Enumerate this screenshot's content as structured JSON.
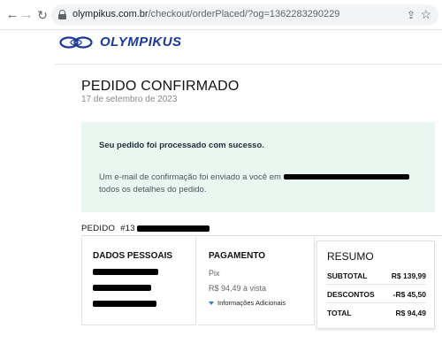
{
  "browser": {
    "url_domain": "olympikus.com.br",
    "url_path": "/checkout/orderPlaced/?og=1362283290229"
  },
  "brand": {
    "name": "OLYMPIKUS",
    "color": "#1c3a9c"
  },
  "page": {
    "title": "PEDIDO CONFIRMADO",
    "date": "17 de setembro de 2023"
  },
  "confirmation": {
    "title": "Seu pedido foi processado com sucesso.",
    "text_before_email": "Um e-mail de confirmação foi enviado a você em",
    "text_after_email": "todos os detalhes do pedido.",
    "background": "#e9f7f1"
  },
  "order": {
    "label": "PEDIDO",
    "number_prefix": "#13"
  },
  "personal": {
    "title": "DADOS PESSOAIS"
  },
  "payment": {
    "title": "PAGAMENTO",
    "method": "Pix",
    "amount": "R$ 94,49 à vista",
    "more_info": "Informações Adicionais"
  },
  "summary": {
    "title": "RESUMO",
    "rows": [
      {
        "label": "SUBTOTAL",
        "value": "R$ 139,99"
      },
      {
        "label": "DESCONTOS",
        "value": "-R$ 45,50"
      },
      {
        "label": "TOTAL",
        "value": "R$ 94,49"
      }
    ]
  }
}
